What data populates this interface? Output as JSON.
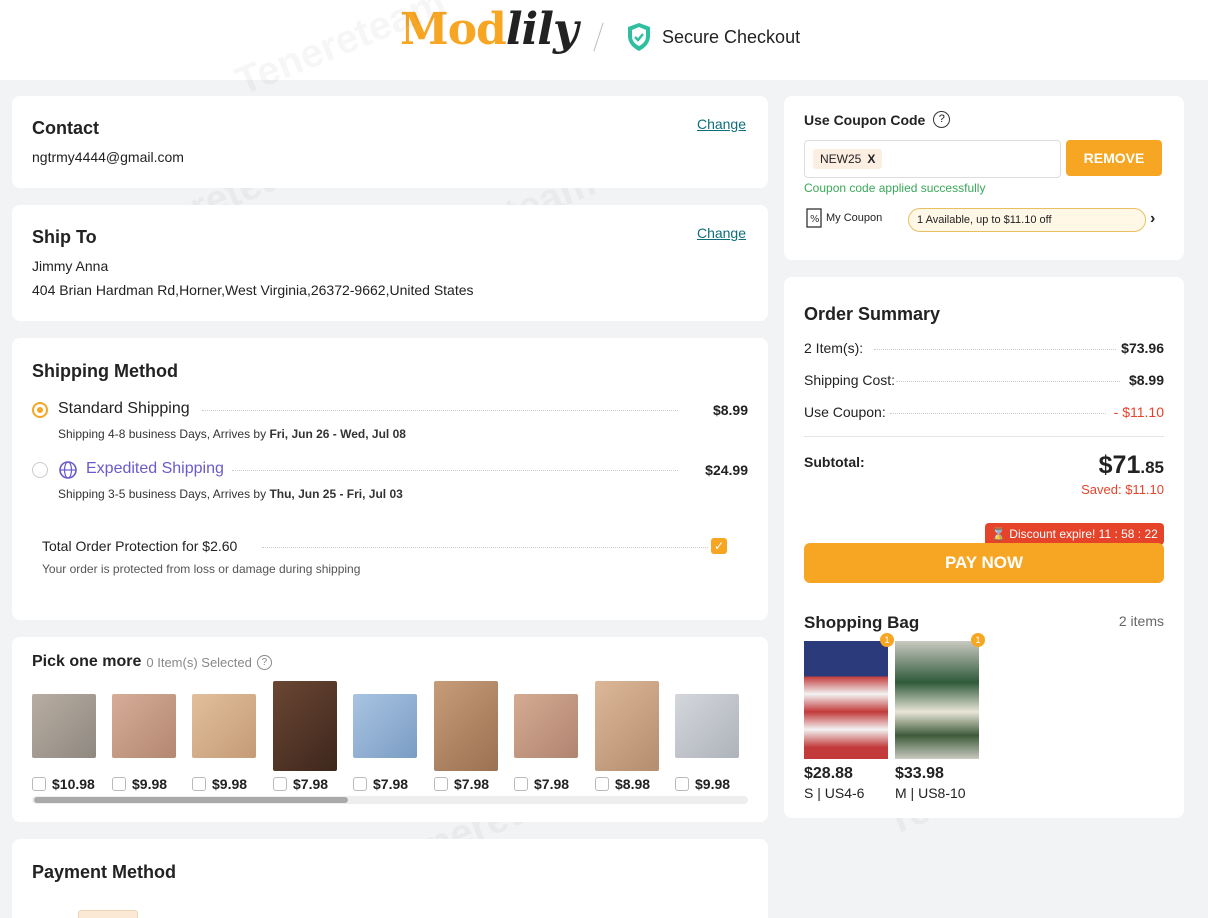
{
  "header": {
    "logo_main": "Mod",
    "logo_script": "lily",
    "secure_label": "Secure Checkout"
  },
  "contact": {
    "title": "Contact",
    "change_label": "Change",
    "email": "ngtrmy4444@gmail.com"
  },
  "ship_to": {
    "title": "Ship To",
    "change_label": "Change",
    "name": "Jimmy Anna",
    "address": "404 Brian Hardman Rd,Horner,West Virginia,26372-9662,United States"
  },
  "shipping_method": {
    "title": "Shipping Method",
    "options": [
      {
        "name": "Standard Shipping",
        "price": "$8.99",
        "desc_prefix": "Shipping 4-8 business Days, Arrives by ",
        "dates": "Fri, Jun 26 - Wed, Jul 08",
        "selected": true
      },
      {
        "name": "Expedited Shipping",
        "price": "$24.99",
        "desc_prefix": "Shipping 3-5 business Days, Arrives by ",
        "dates": "Thu, Jun 25 - Fri, Jul 03",
        "selected": false
      }
    ],
    "protection_label": "Total Order Protection for $2.60",
    "protection_desc": "Your order is protected from loss or damage during shipping",
    "protection_checked": true
  },
  "pick_more": {
    "title": "Pick one more",
    "selected_text": "0 Item(s) Selected",
    "products": [
      {
        "price": "$10.98",
        "color": "#a9a39a"
      },
      {
        "price": "$9.98",
        "color": "#c9a089"
      },
      {
        "price": "$9.98",
        "color": "#d7b290"
      },
      {
        "price": "$7.98",
        "color": "#5a3a2b"
      },
      {
        "price": "$7.98",
        "color": "#8fb2d8"
      },
      {
        "price": "$7.98",
        "color": "#b38a67"
      },
      {
        "price": "$7.98",
        "color": "#c79b82"
      },
      {
        "price": "$8.98",
        "color": "#cfa88a"
      },
      {
        "price": "$9.98",
        "color": "#c9ccd2"
      }
    ]
  },
  "payment": {
    "title": "Payment Method"
  },
  "coupon": {
    "title": "Use Coupon Code",
    "code": "NEW25",
    "remove_mark": "X",
    "remove_label": "REMOVE",
    "success": "Coupon code applied successfully",
    "my_coupon_label": "My Coupon",
    "available_text": "1 Available, up to $11.10 off"
  },
  "summary": {
    "title": "Order Summary",
    "items_label": "2 Item(s):",
    "items_value": "$73.96",
    "shipping_label": "Shipping Cost:",
    "shipping_value": "$8.99",
    "coupon_label": "Use Coupon:",
    "coupon_value": "- $11.10",
    "subtotal_label": "Subtotal:",
    "subtotal_main": "$71",
    "subtotal_cents": ".85",
    "saved": "Saved: $11.10",
    "discount_expire": "Discount expire! 11 : 58 : 22",
    "pay_label": "PAY NOW"
  },
  "bag": {
    "title": "Shopping Bag",
    "count": "2 items",
    "items": [
      {
        "price": "$28.88",
        "size": "S | US4-6",
        "qty": "1"
      },
      {
        "price": "$33.98",
        "size": "M | US8-10",
        "qty": "1"
      }
    ]
  },
  "colors": {
    "accent": "#f6a623",
    "link": "#0e6f7a",
    "success": "#3aa85a",
    "danger": "#e6432b",
    "expedited": "#6a5acd"
  }
}
